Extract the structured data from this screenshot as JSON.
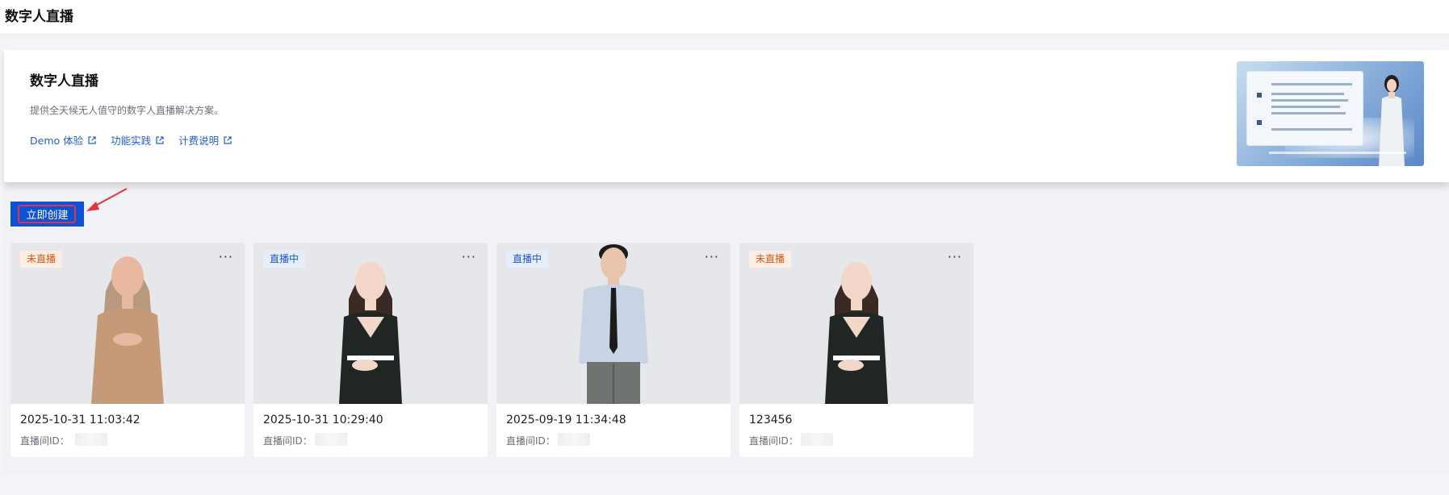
{
  "header": {
    "title": "数字人直播"
  },
  "intro": {
    "heading": "数字人直播",
    "description": "提供全天候无人值守的数字人直播解决方案。",
    "links": [
      {
        "label": "Demo 体验",
        "icon": "external-link-icon"
      },
      {
        "label": "功能实践",
        "icon": "external-link-icon"
      },
      {
        "label": "计费说明",
        "icon": "external-link-icon"
      }
    ]
  },
  "actions": {
    "create_label": "立即创建"
  },
  "cards": [
    {
      "status": "未直播",
      "title": "2025-10-31 11:03:42",
      "room_label": "直播间ID：",
      "more": "···"
    },
    {
      "status": "直播中",
      "title": "2025-10-31 10:29:40",
      "room_label": "直播间ID：",
      "more": "···"
    },
    {
      "status": "直播中",
      "title": "2025-09-19 11:34:48",
      "room_label": "直播间ID：",
      "more": "···"
    },
    {
      "status": "未直播",
      "title": "123456",
      "room_label": "直播间ID：",
      "more": "···"
    }
  ],
  "colors": {
    "primary": "#0c52d9",
    "link": "#1f5fd6",
    "status_off_text": "#d2571a",
    "status_on_text": "#1f56c8",
    "highlight": "#e5343c"
  }
}
